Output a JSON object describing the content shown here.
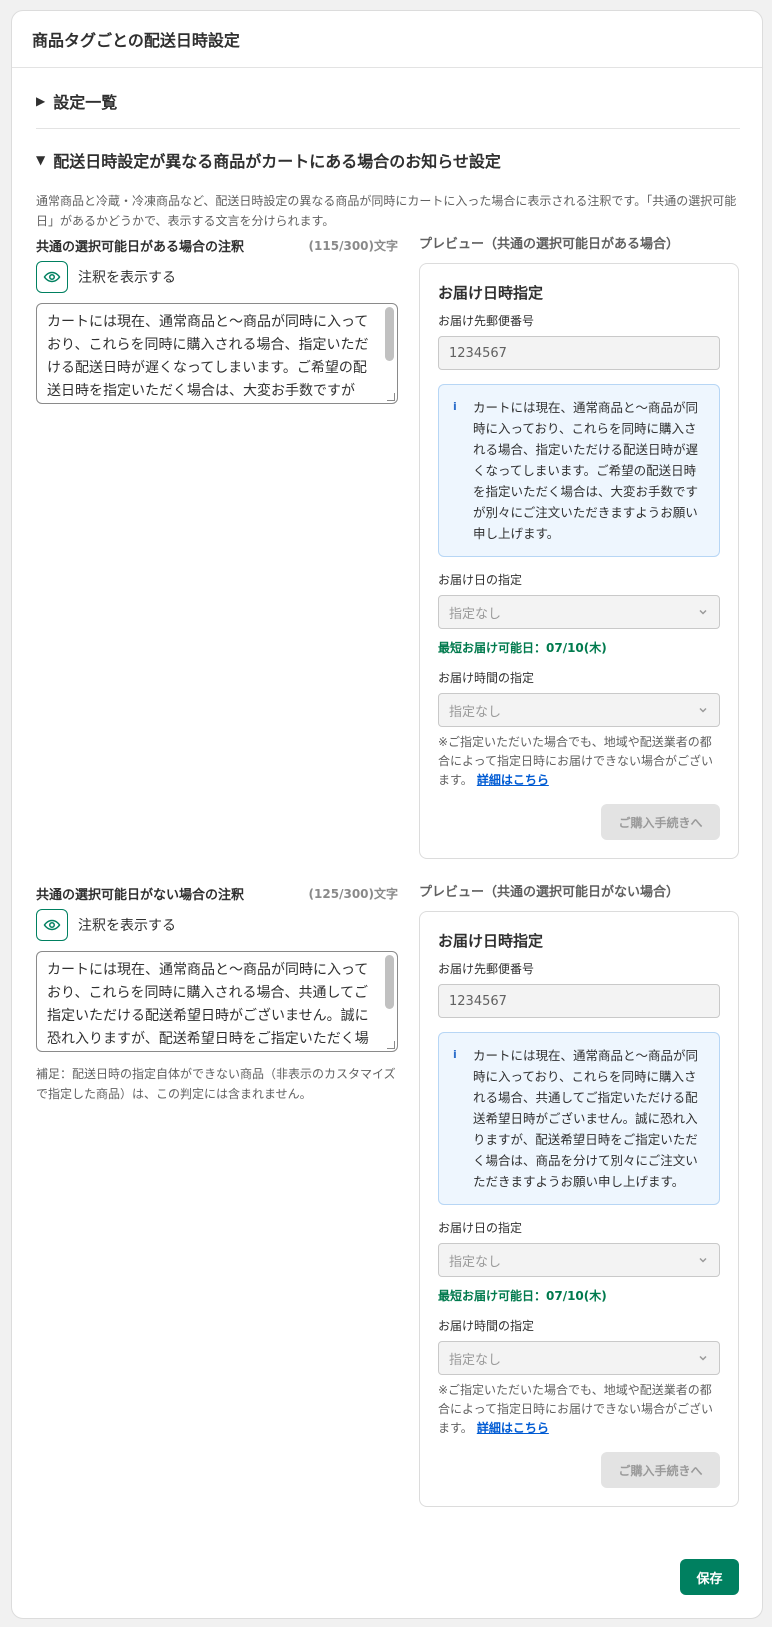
{
  "card": {
    "title": "商品タグごとの配送日時設定"
  },
  "settings_list": {
    "label": "設定一覧"
  },
  "notice": {
    "label": "配送日時設定が異なる商品がカートにある場合のお知らせ設定",
    "description": "通常商品と冷蔵・冷凍商品など、配送日時設定の異なる商品が同時にカートに入った場合に表示される注釈です。「共通の選択可能日」があるかどうかで、表示する文言を分けられます。"
  },
  "section_with": {
    "label": "共通の選択可能日がある場合の注釈",
    "counter": "(115/300)文字",
    "toggle_label": "注釈を表示する",
    "text": "カートには現在、通常商品と〜商品が同時に入っており、これらを同時に購入される場合、指定いただける配送日時が遅くなってしまいます。ご希望の配送日時を指定いただく場合は、大変お手数ですが別々にご注文いただきますようお願い申し上げます。",
    "preview_title": "プレビュー（共通の選択可能日がある場合）"
  },
  "section_without": {
    "label": "共通の選択可能日がない場合の注釈",
    "counter": "(125/300)文字",
    "toggle_label": "注釈を表示する",
    "text": "カートには現在、通常商品と〜商品が同時に入っており、これらを同時に購入される場合、共通してご指定いただける配送希望日時がございません。誠に恐れ入りますが、配送希望日時をご指定いただく場合は、商品を分けて別々にご注文いただきますようお願い申し上げます。",
    "note": "補足：配送日時の指定自体ができない商品（非表示のカスタマイズで指定した商品）は、この判定には含まれません。",
    "preview_title": "プレビュー（共通の選択可能日がない場合）"
  },
  "preview": {
    "heading": "お届け日時指定",
    "postal_label": "お届け先郵便番号",
    "postal_value": "1234567",
    "info_icon": "i",
    "date_label": "お届け日の指定",
    "date_value": "指定なし",
    "earliest": "最短お届け可能日：07/10(木)",
    "time_label": "お届け時間の指定",
    "time_value": "指定なし",
    "disclaimer": "※ご指定いただいた場合でも、地域や配送業者の都合によって指定日時にお届けできない場合がございます。",
    "link": "詳細はこちら",
    "checkout": "ご購入手続きへ"
  },
  "save": "保存",
  "colors": {
    "accent": "#008060",
    "info_bg": "#eef6fe",
    "info_border": "#b7d6f5",
    "earliest": "#007a4d",
    "link": "#005bd3"
  },
  "icons": {
    "caret_right": "▶",
    "caret_down": "▼",
    "eye": "eye-icon",
    "info": "info-icon",
    "chevron": "chevron-down-icon"
  }
}
